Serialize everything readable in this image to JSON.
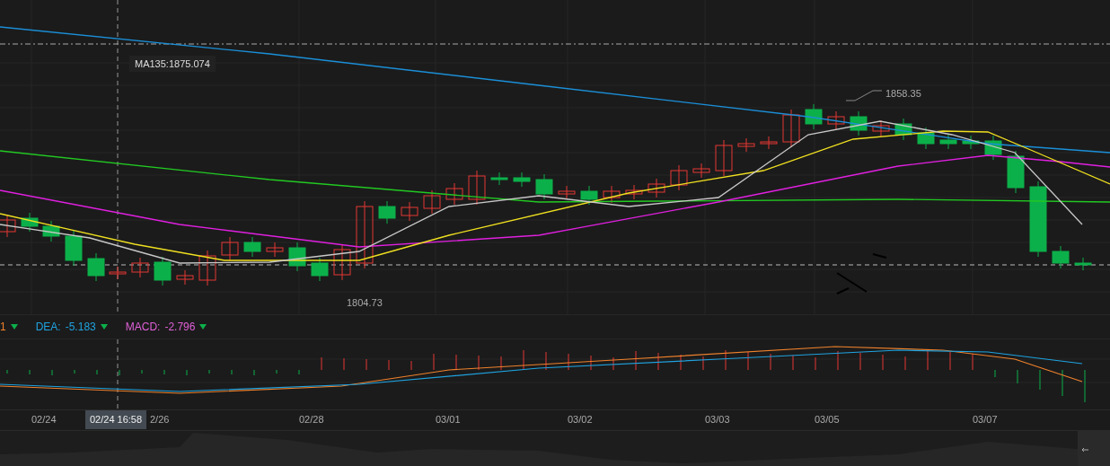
{
  "main_chart": {
    "ma_label": "MA135:1875.074",
    "high_label": "1858.35",
    "low_label": "1804.73"
  },
  "macd_legend": [
    {
      "value": "1",
      "color": "#f0822c"
    },
    {
      "label": "DEA:",
      "value": "-5.183",
      "color": "#1fa3e0"
    },
    {
      "label": "MACD:",
      "value": "-2.796",
      "color": "#e060d8"
    }
  ],
  "x_axis": [
    "02/24",
    "2/26",
    "02/28",
    "03/01",
    "03/02",
    "03/03",
    "03/05",
    "03/07"
  ],
  "crosshair_time": "02/24 16:58"
}
